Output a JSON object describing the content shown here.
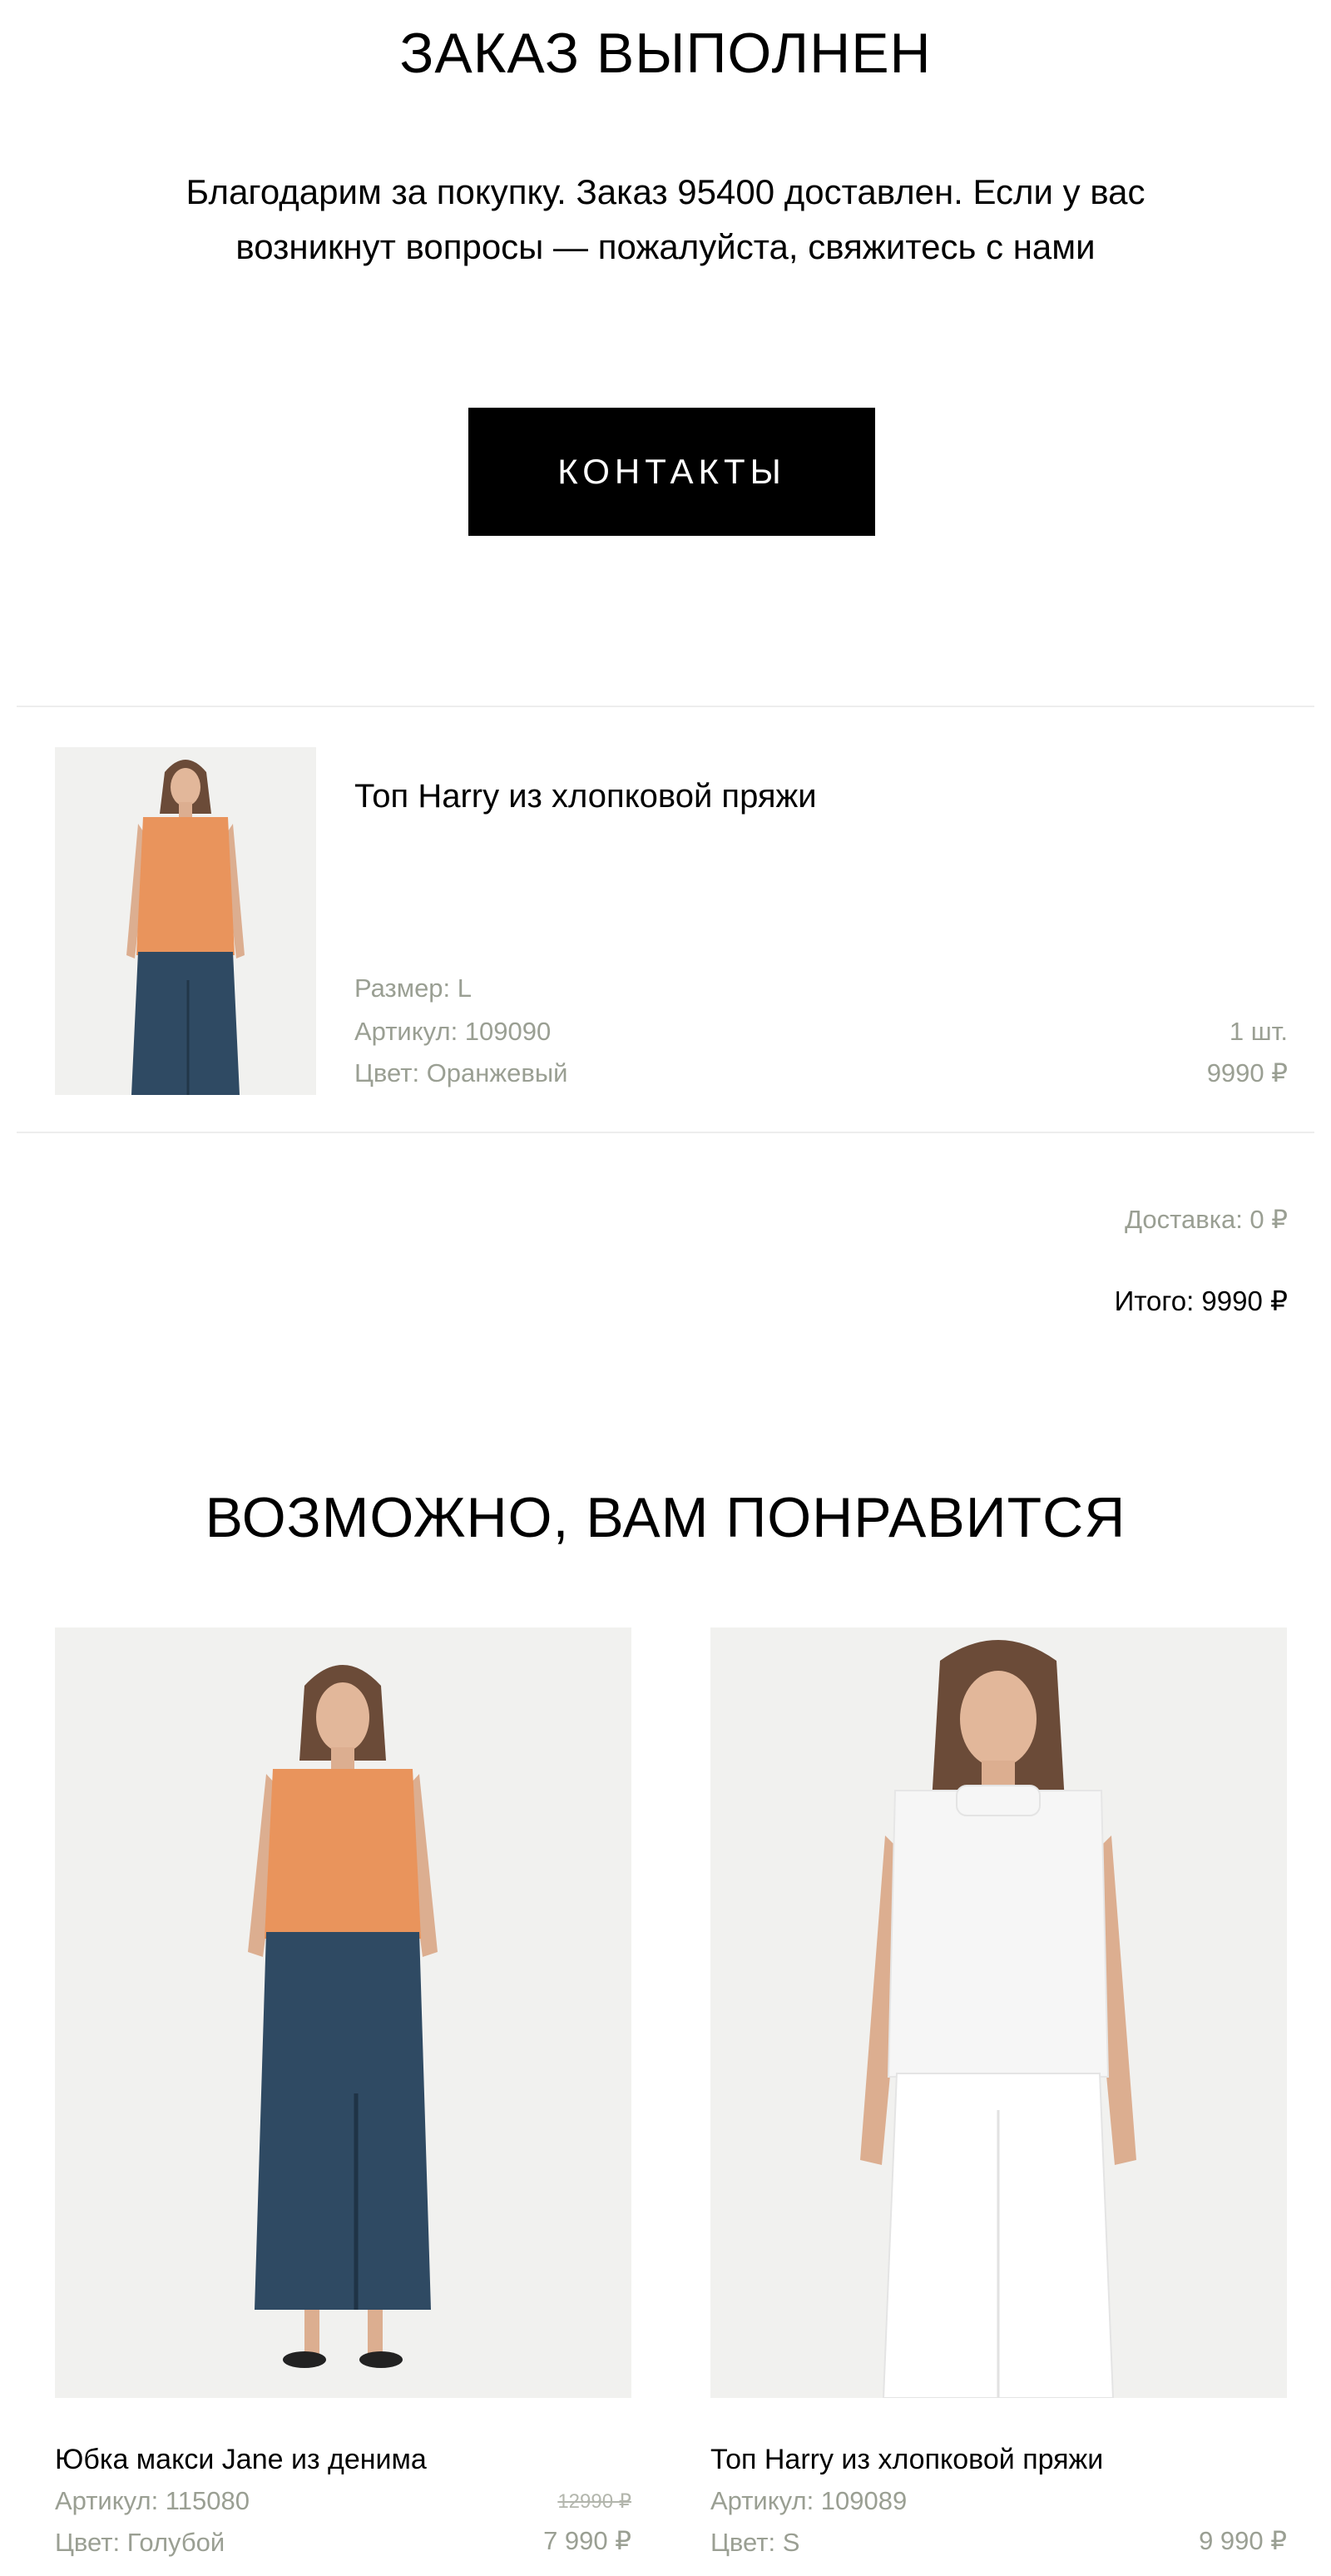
{
  "header": {
    "title": "ЗАКАЗ ВЫПОЛНЕН",
    "intro_line1": "Благодарим за покупку. Заказ 95400 доставлен. Если у вас",
    "intro_line2": "возникнут вопросы — пожалуйста, свяжитесь с нами",
    "contacts_button": "КОНТАКТЫ"
  },
  "order": {
    "item": {
      "name": "Топ Harry из хлопковой пряжи",
      "size": "Размер: L",
      "article": "Артикул: 109090",
      "color": "Цвет: Оранжевый",
      "quantity": "1 шт.",
      "price": "9990 ₽",
      "image_icon": "product-photo-orange-top"
    },
    "delivery": "Доставка: 0 ₽",
    "total": "Итого: 9990 ₽"
  },
  "recommendations": {
    "title": "ВОЗМОЖНО, ВАМ ПОНРАВИТСЯ",
    "items": [
      {
        "name": "Юбка макси Jane из денима",
        "article": "Артикул: 115080",
        "color": "Цвет: Голубой",
        "old_price": "12990 ₽",
        "price": "7 990 ₽",
        "image_icon": "product-photo-denim-skirt"
      },
      {
        "name": "Топ Harry из хлопковой пряжи",
        "article": "Артикул: 109089",
        "color": "Цвет: S",
        "price": "9 990 ₽",
        "image_icon": "product-photo-white-top"
      }
    ]
  },
  "colors": {
    "muted_text": "#9a9f93",
    "button_bg": "#000000",
    "button_text": "#ffffff",
    "image_bg": "#f1f1ef",
    "orange_top": "#e9945c",
    "denim": "#2f4a63",
    "white_top": "#f6f6f6"
  }
}
